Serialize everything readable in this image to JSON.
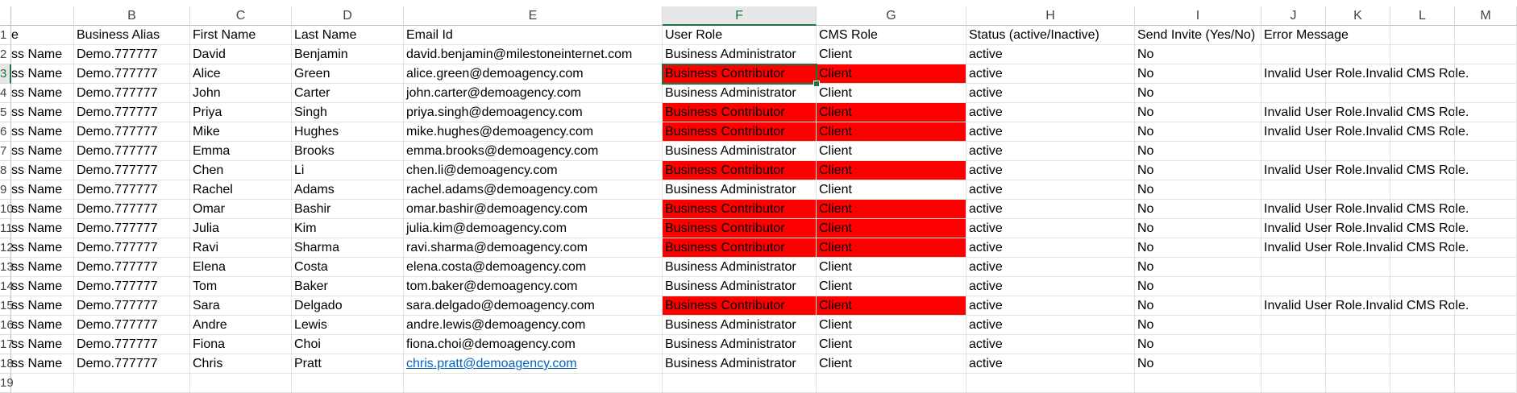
{
  "columns": [
    {
      "letter": "",
      "left": 0
    },
    {
      "letter": "B"
    },
    {
      "letter": "C"
    },
    {
      "letter": "D"
    },
    {
      "letter": "E"
    },
    {
      "letter": "F"
    },
    {
      "letter": "G"
    },
    {
      "letter": "H"
    },
    {
      "letter": "I"
    },
    {
      "letter": "J"
    },
    {
      "letter": "K"
    },
    {
      "letter": "L"
    },
    {
      "letter": "M"
    }
  ],
  "partial_col_label": "e",
  "selected_column": "F",
  "selected_row": 3,
  "selected_cell": "F3",
  "colors": {
    "error_fill": "#ff0000",
    "link": "#0563c1",
    "selection": "#217346"
  },
  "rows": [
    {
      "num": "1",
      "cells": [
        "e",
        "Business Alias",
        "First Name",
        "Last Name",
        "Email Id",
        "User Role",
        "CMS Role",
        "Status (active/Inactive)",
        "Send Invite (Yes/No)",
        "Error Message",
        "",
        "",
        ""
      ],
      "error": false
    },
    {
      "num": "2",
      "cells": [
        "ss Name",
        "Demo.777777",
        "David",
        "Benjamin",
        "david.benjamin@milestoneinternet.com",
        "Business Administrator",
        "Client",
        "active",
        "No",
        "",
        "",
        "",
        ""
      ],
      "error": false
    },
    {
      "num": "3",
      "cells": [
        "ss Name",
        "Demo.777777",
        "Alice",
        "Green",
        "alice.green@demoagency.com",
        "Business Contributor",
        "Client",
        "active",
        "No",
        "Invalid User Role.Invalid CMS Role.",
        "",
        "",
        ""
      ],
      "error": true
    },
    {
      "num": "4",
      "cells": [
        "ss Name",
        "Demo.777777",
        "John",
        "Carter",
        "john.carter@demoagency.com",
        "Business Administrator",
        "Client",
        "active",
        "No",
        "",
        "",
        "",
        ""
      ],
      "error": false
    },
    {
      "num": "5",
      "cells": [
        "ss Name",
        "Demo.777777",
        "Priya",
        "Singh",
        "priya.singh@demoagency.com",
        "Business Contributor",
        "Client",
        "active",
        "No",
        "Invalid User Role.Invalid CMS Role.",
        "",
        "",
        ""
      ],
      "error": true
    },
    {
      "num": "6",
      "cells": [
        "ss Name",
        "Demo.777777",
        "Mike",
        "Hughes",
        "mike.hughes@demoagency.com",
        "Business Contributor",
        "Client",
        "active",
        "No",
        "Invalid User Role.Invalid CMS Role.",
        "",
        "",
        ""
      ],
      "error": true
    },
    {
      "num": "7",
      "cells": [
        "ss Name",
        "Demo.777777",
        "Emma",
        "Brooks",
        "emma.brooks@demoagency.com",
        "Business Administrator",
        "Client",
        "active",
        "No",
        "",
        "",
        "",
        ""
      ],
      "error": false
    },
    {
      "num": "8",
      "cells": [
        "ss Name",
        "Demo.777777",
        "Chen",
        "Li",
        "chen.li@demoagency.com",
        "Business Contributor",
        "Client",
        "active",
        "No",
        "Invalid User Role.Invalid CMS Role.",
        "",
        "",
        ""
      ],
      "error": true
    },
    {
      "num": "9",
      "cells": [
        "ss Name",
        "Demo.777777",
        "Rachel",
        "Adams",
        "rachel.adams@demoagency.com",
        "Business Administrator",
        "Client",
        "active",
        "No",
        "",
        "",
        "",
        ""
      ],
      "error": false
    },
    {
      "num": "10",
      "cells": [
        "ss Name",
        "Demo.777777",
        "Omar",
        "Bashir",
        "omar.bashir@demoagency.com",
        "Business Contributor",
        "Client",
        "active",
        "No",
        "Invalid User Role.Invalid CMS Role.",
        "",
        "",
        ""
      ],
      "error": true
    },
    {
      "num": "11",
      "cells": [
        "ss Name",
        "Demo.777777",
        "Julia",
        "Kim",
        "julia.kim@demoagency.com",
        "Business Contributor",
        "Client",
        "active",
        "No",
        "Invalid User Role.Invalid CMS Role.",
        "",
        "",
        ""
      ],
      "error": true
    },
    {
      "num": "12",
      "cells": [
        "ss Name",
        "Demo.777777",
        "Ravi",
        "Sharma",
        "ravi.sharma@demoagency.com",
        "Business Contributor",
        "Client",
        "active",
        "No",
        "Invalid User Role.Invalid CMS Role.",
        "",
        "",
        ""
      ],
      "error": true
    },
    {
      "num": "13",
      "cells": [
        "ss Name",
        "Demo.777777",
        "Elena",
        "Costa",
        "elena.costa@demoagency.com",
        "Business Administrator",
        "Client",
        "active",
        "No",
        "",
        "",
        "",
        ""
      ],
      "error": false
    },
    {
      "num": "14",
      "cells": [
        "ss Name",
        "Demo.777777",
        "Tom",
        "Baker",
        "tom.baker@demoagency.com",
        "Business Administrator",
        "Client",
        "active",
        "No",
        "",
        "",
        "",
        ""
      ],
      "error": false
    },
    {
      "num": "15",
      "cells": [
        "ss Name",
        "Demo.777777",
        "Sara",
        "Delgado",
        "sara.delgado@demoagency.com",
        "Business Contributor",
        "Client",
        "active",
        "No",
        "Invalid User Role.Invalid CMS Role.",
        "",
        "",
        ""
      ],
      "error": true
    },
    {
      "num": "16",
      "cells": [
        "ss Name",
        "Demo.777777",
        "Andre",
        "Lewis",
        "andre.lewis@demoagency.com",
        "Business Administrator",
        "Client",
        "active",
        "No",
        "",
        "",
        "",
        ""
      ],
      "error": false
    },
    {
      "num": "17",
      "cells": [
        "ss Name",
        "Demo.777777",
        "Fiona",
        "Choi",
        "fiona.choi@demoagency.com",
        "Business Administrator",
        "Client",
        "active",
        "No",
        "",
        "",
        "",
        ""
      ],
      "error": false
    },
    {
      "num": "18",
      "cells": [
        "ss Name",
        "Demo.777777",
        "Chris",
        "Pratt",
        "chris.pratt@demoagency.com",
        "Business Administrator",
        "Client",
        "active",
        "No",
        "",
        "",
        "",
        ""
      ],
      "error": false,
      "link_col": 4
    },
    {
      "num": "19",
      "cells": [
        "",
        "",
        "",
        "",
        "",
        "",
        "",
        "",
        "",
        "",
        "",
        "",
        ""
      ],
      "error": false
    }
  ]
}
